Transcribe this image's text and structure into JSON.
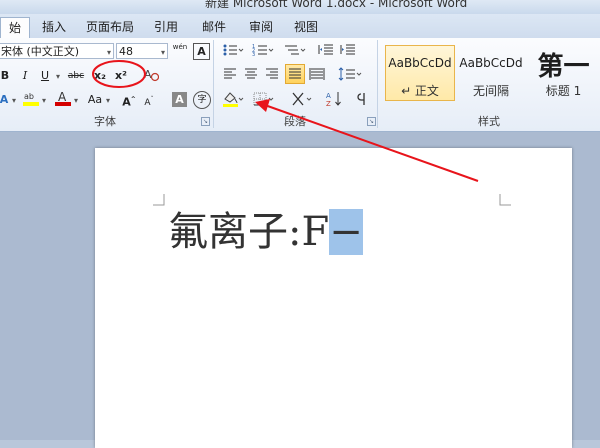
{
  "window": {
    "title": "新建 Microsoft Word 1.docx - Microsoft Word"
  },
  "tabs": [
    {
      "label": "开始",
      "shown": "始",
      "active": true
    },
    {
      "label": "插入"
    },
    {
      "label": "页面布局"
    },
    {
      "label": "引用"
    },
    {
      "label": "邮件"
    },
    {
      "label": "审阅"
    },
    {
      "label": "视图"
    }
  ],
  "font_group": {
    "label": "字体",
    "font_name": "宋体 (中文正文)",
    "font_name_shown": "宋体 (中文正文)",
    "font_size": "48",
    "bold": "B",
    "italic": "I",
    "underline": "U",
    "strike": "abc",
    "subscript": "x₂",
    "superscript": "x²",
    "grow_font": "A",
    "shrink_font": "A",
    "change_case": "Aa",
    "char_shade": "A",
    "phonetic": "wén",
    "border_char": "A",
    "enclose_char": "字"
  },
  "paragraph_group": {
    "label": "段落"
  },
  "styles_group": {
    "label": "样式",
    "styles": [
      {
        "sample": "AaBbCcDd",
        "name": "↵ 正文",
        "selected": true
      },
      {
        "sample": "AaBbCcDd",
        "name": "无间隔"
      },
      {
        "sample": "第一",
        "name": "标题 1"
      }
    ]
  },
  "document": {
    "text_main": "氟离子:F",
    "text_selected": "−"
  },
  "colors": {
    "highlight_yellow": "#ffff00",
    "font_red": "#d40000",
    "annotation_red": "#e8141b"
  }
}
